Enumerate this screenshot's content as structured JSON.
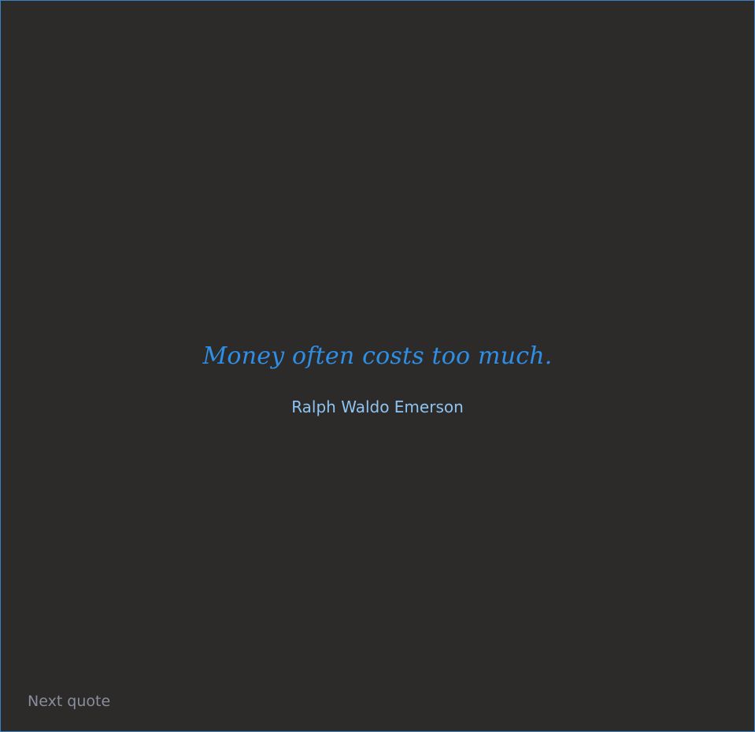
{
  "quote": {
    "text": "Money often costs too much.",
    "author": "Ralph Waldo Emerson"
  },
  "controls": {
    "next_label": "Next quote"
  },
  "colors": {
    "background": "#2c2b29",
    "border": "#3a82c4",
    "quote": "#2f8ee6",
    "author": "#8ec3f2",
    "next": "#8a8e9c"
  }
}
